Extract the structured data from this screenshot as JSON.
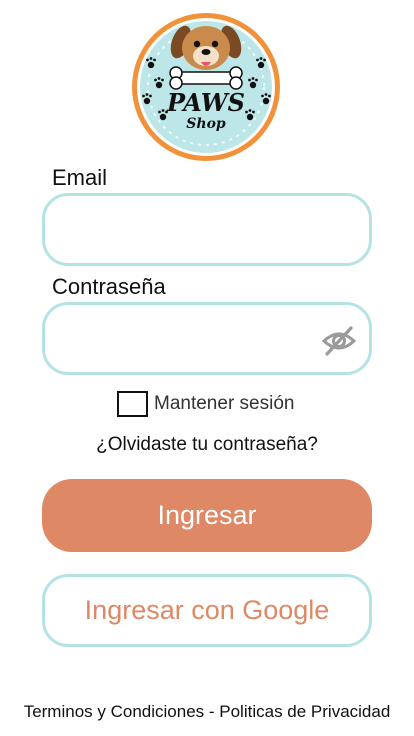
{
  "logo": {
    "title_text": "PAWS",
    "subtitle_text": "Shop",
    "colors": {
      "ring_outer": "#f1923a",
      "ring_inner": "#bde6e8",
      "dog_fur": "#c98a4b",
      "dog_ears": "#7a4a22",
      "tongue": "#e8556d"
    }
  },
  "form": {
    "email_label": "Email",
    "email_value": "",
    "password_label": "Contraseña",
    "password_value": "",
    "password_visibility_icon": "eye-slash-icon",
    "remember_label": "Mantener sesión",
    "remember_checked": false,
    "forgot_link": "¿Olvidaste tu contraseña?",
    "login_button": "Ingresar",
    "google_button": "Ingresar con Google"
  },
  "footer": {
    "terms": "Terminos y Condiciones",
    "separator": " - ",
    "privacy": "Politicas de Privacidad"
  },
  "colors": {
    "accent": "#de8866",
    "input_border": "#b5e3e3",
    "text": "#111111"
  }
}
